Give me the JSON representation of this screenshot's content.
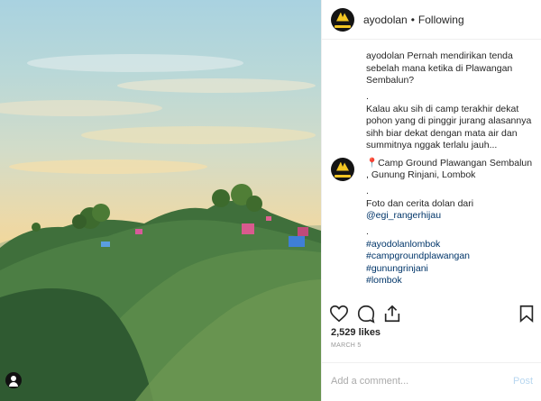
{
  "post": {
    "username": "ayodolan",
    "separator": "•",
    "follow_status": "Following"
  },
  "caption": {
    "text": "ayodolan Pernah mendirikan tenda sebelah mana ketika di Plawangan Sembalun?",
    "spacer": ".",
    "text2": "Kalau aku sih di camp terakhir dekat pohon yang di pinggir jurang alasannya sihh biar dekat dengan mata air dan summitnya nggak terlalu jauh..."
  },
  "reply": {
    "location": "📍Camp Ground Plawangan Sembalun , Gunung Rinjani, Lombok",
    "spacer": ".",
    "credit": "Foto dan cerita dolan dari",
    "mention": "@egi_rangerhijau",
    "spacer2": ".",
    "hashtags": [
      "#ayodolanlombok",
      "#campgroundplawangan",
      "#gunungrinjani",
      "#lombok"
    ]
  },
  "stats": {
    "likes": "2,529 likes",
    "date": "MARCH 5"
  },
  "comment_box": {
    "placeholder": "Add a comment...",
    "post_label": "Post"
  },
  "icons": {
    "like": "heart-icon",
    "comment": "comment-icon",
    "share": "share-icon",
    "save": "bookmark-icon",
    "tag": "user-tag-icon"
  }
}
